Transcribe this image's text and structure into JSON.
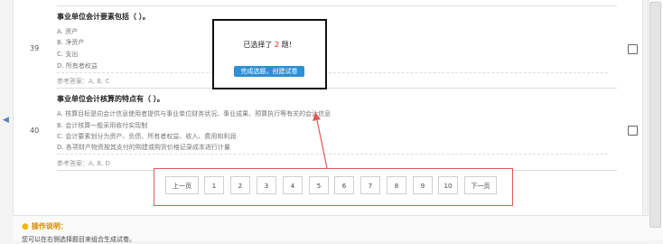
{
  "questions": [
    {
      "number": "39",
      "title": "事业单位会计要素包括（ ）。",
      "options": [
        "A. 资产",
        "B. 净资产",
        "C. 支出",
        "D. 所有者权益"
      ],
      "answer": "参考答案：A, B, C"
    },
    {
      "number": "40",
      "title": "事业单位会计核算的特点有（ ）。",
      "options": [
        "A. 核算目标是向会计信息使用者提供与事业单位财务状况、事业成果、预算执行等有关的会计信息",
        "B. 会计核算一般采用收付实现制",
        "C. 会计要素划分为资产、负债、所有者权益、收入、费用和利润",
        "D. 各项财产物资按其支付的购建或购货价格记录成本进行计量"
      ],
      "answer": "参考答案：A, B, D"
    }
  ],
  "modal": {
    "prefix": "已选择了",
    "count": "2",
    "suffix": "题！",
    "button": "完成选题，创建试卷"
  },
  "pager": {
    "prev": "上一页",
    "pages": [
      "1",
      "2",
      "3",
      "4",
      "5",
      "6",
      "7",
      "8",
      "9",
      "10"
    ],
    "next": "下一页"
  },
  "footer": {
    "title": "操作说明：",
    "text": "您可以在右侧选择题目来组合生成试卷。"
  },
  "colors": {
    "highlight": "#e05a5a",
    "button": "#2d8fd5",
    "count": "#e02020"
  }
}
